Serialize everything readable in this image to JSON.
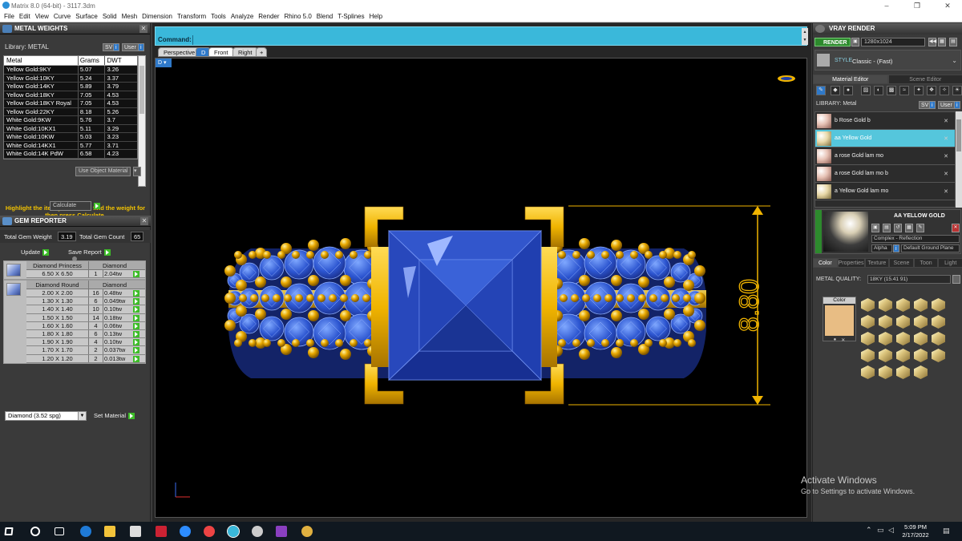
{
  "window": {
    "title": "Matrix 8.0 (64-bit) - 3117.3dm",
    "controls": [
      "–",
      "❐",
      "✕"
    ]
  },
  "menu": [
    "File",
    "Edit",
    "View",
    "Curve",
    "Surface",
    "Solid",
    "Mesh",
    "Dimension",
    "Transform",
    "Tools",
    "Analyze",
    "Render",
    "Rhino 5.0",
    "Blend",
    "T-Splines",
    "Help"
  ],
  "metal_weights": {
    "title": "METAL WEIGHTS",
    "library_label": "Library: METAL",
    "btn_sv": "SV",
    "btn_user": "User",
    "columns": [
      "Metal",
      "Grams",
      "DWT"
    ],
    "rows": [
      [
        "Yellow Gold:9KY",
        "5.07",
        "3.26"
      ],
      [
        "Yellow Gold:10KY",
        "5.24",
        "3.37"
      ],
      [
        "Yellow Gold:14KY",
        "5.89",
        "3.79"
      ],
      [
        "Yellow Gold:18KY",
        "7.05",
        "4.53"
      ],
      [
        "Yellow Gold:18KY Royal",
        "7.05",
        "4.53"
      ],
      [
        "Yellow Gold:22KY",
        "8.18",
        "5.26"
      ],
      [
        "White Gold:9KW",
        "5.76",
        "3.7"
      ],
      [
        "White Gold:10KX1",
        "5.11",
        "3.29"
      ],
      [
        "White Gold:10KW",
        "5.03",
        "3.23"
      ],
      [
        "White Gold:14KX1",
        "5.77",
        "3.71"
      ],
      [
        "White Gold:14K PdW",
        "6.58",
        "4.23"
      ]
    ],
    "use_object_material": "Use Object Material",
    "hint": "Highlight the item you want to find the weight for then press Calculate.",
    "calculate": "Calculate"
  },
  "gem_reporter": {
    "title": "GEM REPORTER",
    "total_weight_label": "Total Gem Weight",
    "total_weight_value": "3.19",
    "total_count_label": "Total Gem Count",
    "total_count_value": "65",
    "update": "Update",
    "save_report": "Save Report",
    "groups": [
      {
        "name": "Diamond Princess",
        "type": "Diamond",
        "rows": [
          [
            "6.50 X 6.50",
            "1",
            "2.04tw"
          ]
        ]
      },
      {
        "name": "Diamond Round",
        "type": "Diamond",
        "rows": [
          [
            "2.00 X 2.00",
            "16",
            "0.48tw"
          ],
          [
            "1.30 X 1.30",
            "6",
            "0.049tw"
          ],
          [
            "1.40 X 1.40",
            "10",
            "0.10tw"
          ],
          [
            "1.50 X 1.50",
            "14",
            "0.18tw"
          ],
          [
            "1.60 X 1.60",
            "4",
            "0.06tw"
          ],
          [
            "1.80 X 1.80",
            "6",
            "0.13tw"
          ],
          [
            "1.90 X 1.90",
            "4",
            "0.10tw"
          ],
          [
            "1.70 X 1.70",
            "2",
            "0.037tw"
          ],
          [
            "1.20 X 1.20",
            "2",
            "0.013tw"
          ]
        ]
      }
    ],
    "material_select": "Diamond    (3.52 spg)",
    "set_material": "Set Material"
  },
  "command": {
    "label": "Command:"
  },
  "viewport_tabs": [
    "Perspective",
    "D",
    "Front",
    "Right",
    "+"
  ],
  "viewport_tag": "D",
  "viewport": {
    "dimension_text": "8.80"
  },
  "vray": {
    "title": "VRAY RENDER",
    "render": "RENDER",
    "resolution": "1280x1024",
    "style_label": "STYLE",
    "style_value": "Classic - (Fast)",
    "tabs_top": [
      "Material Editor",
      "Scene Editor"
    ],
    "library_label": "LIBRARY: Metal",
    "btn_sv": "SV",
    "btn_user": "User",
    "materials": [
      "b Rose Gold b",
      "aa Yellow Gold",
      "a rose Gold lam mo",
      "a rose Gold lam mo b",
      "a Yellow Gold lam mo"
    ],
    "selected_material": "AA YELLOW GOLD",
    "complex": "Complex - Reflection",
    "alpha": "Alpha",
    "ground": "Default Ground Plane",
    "tabs_bottom": [
      "Color",
      "Properties",
      "Texture",
      "Scene",
      "Toon",
      "Light"
    ],
    "metal_quality_label": "METAL QUALITY:",
    "metal_quality_value": "18KY         (15.41 91)",
    "color_label": "Color"
  },
  "watermark": {
    "line1": "Activate Windows",
    "line2": "Go to Settings to activate Windows."
  },
  "clock": {
    "time": "5:09 PM",
    "date": "2/17/2022"
  },
  "colors": {
    "gold": "#f0b400",
    "stone_blue": "#1e3ea8",
    "accent_cyan": "#3ab8da",
    "swatch": "#e8bd84"
  }
}
